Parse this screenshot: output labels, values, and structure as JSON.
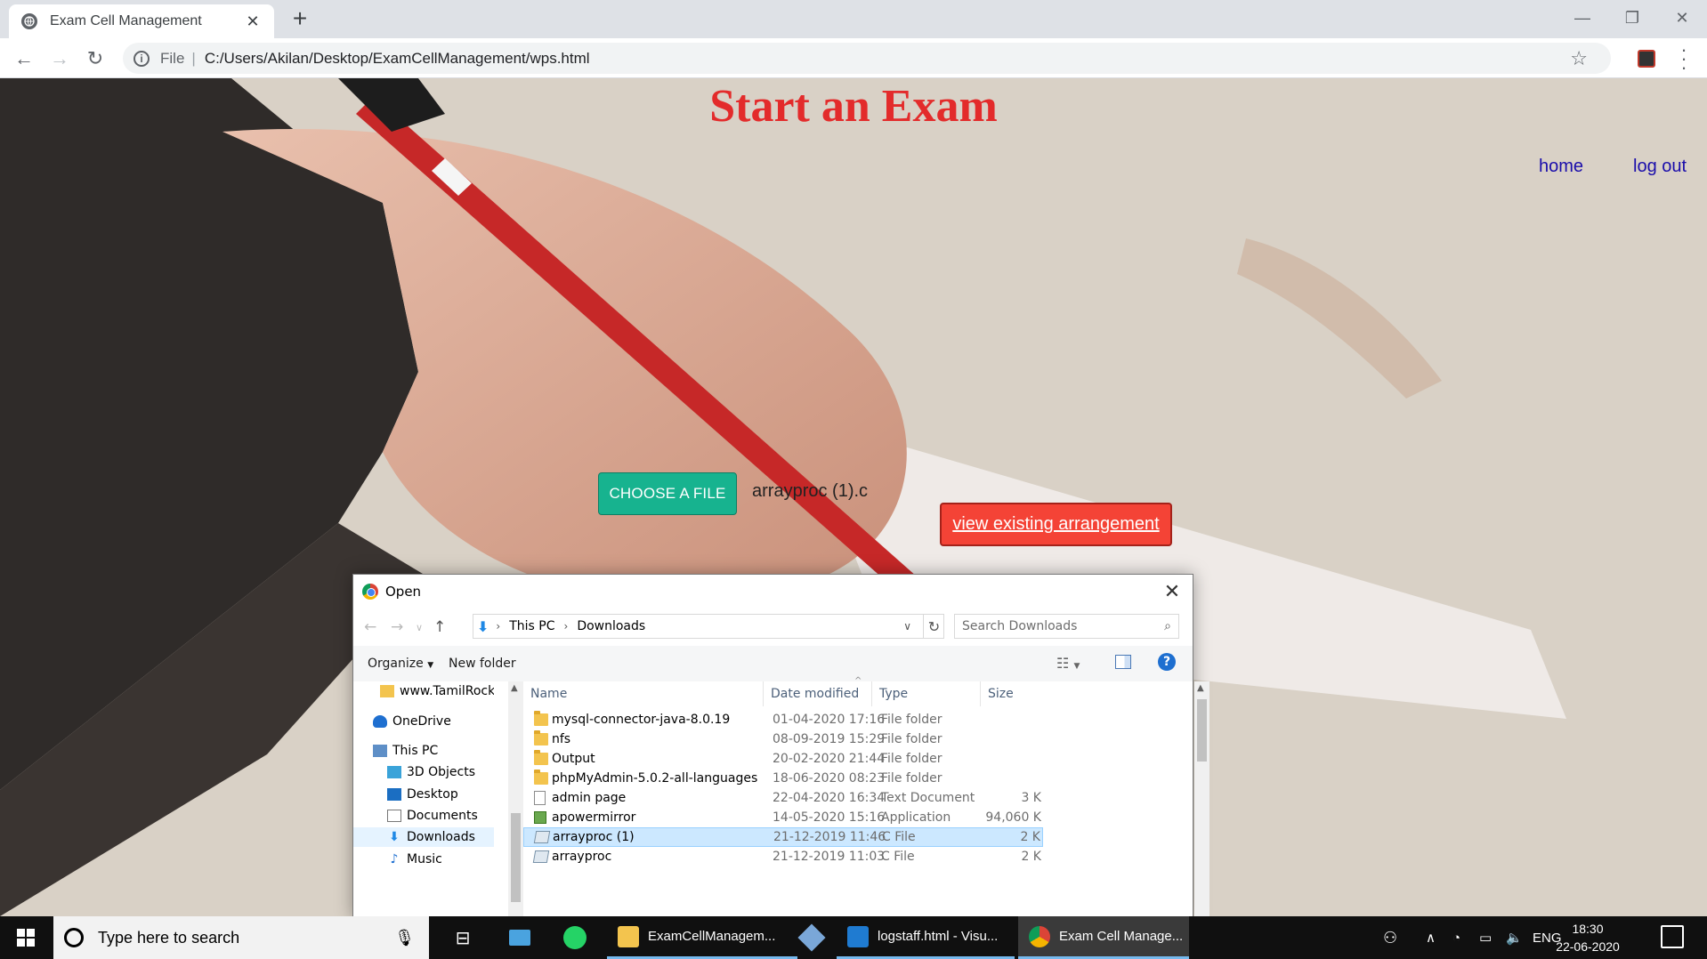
{
  "browser": {
    "tab_title": "Exam Cell Management",
    "new_tab_symbol": "+",
    "scheme_label": "File",
    "url": "C:/Users/Akilan/Desktop/ExamCellManagement/wps.html"
  },
  "page": {
    "title": "Start an Exam",
    "nav": {
      "home": "home",
      "logout": "log out"
    },
    "choose_file_label": "CHOOSE A FILE",
    "chosen_file_name": "arrayproc (1).c",
    "view_arrangement_label": "view existing arrangement",
    "colors": {
      "title": "#e32b2b",
      "choose_button": "#17b38f",
      "view_button": "#f44336",
      "link": "#1a0dab"
    }
  },
  "dialog": {
    "title": "Open",
    "breadcrumb": [
      "This PC",
      "Downloads"
    ],
    "search_placeholder": "Search Downloads",
    "organize_label": "Organize",
    "new_folder_label": "New folder",
    "nav_items": [
      {
        "label": "www.TamilRocke",
        "icon": "folder-icon"
      },
      {
        "label": "OneDrive",
        "icon": "onedrive-icon"
      },
      {
        "label": "This PC",
        "icon": "this-pc-icon"
      },
      {
        "label": "3D Objects",
        "icon": "3d-objects-icon"
      },
      {
        "label": "Desktop",
        "icon": "desktop-icon"
      },
      {
        "label": "Documents",
        "icon": "documents-icon"
      },
      {
        "label": "Downloads",
        "icon": "downloads-icon"
      },
      {
        "label": "Music",
        "icon": "music-icon"
      }
    ],
    "columns": {
      "name": "Name",
      "date": "Date modified",
      "type": "Type",
      "size": "Size"
    },
    "files": [
      {
        "name": "mysql-connector-java-8.0.19",
        "date": "01-04-2020 17:16",
        "type": "File folder",
        "size": "",
        "icon": "folder"
      },
      {
        "name": "nfs",
        "date": "08-09-2019 15:29",
        "type": "File folder",
        "size": "",
        "icon": "folder"
      },
      {
        "name": "Output",
        "date": "20-02-2020 21:44",
        "type": "File folder",
        "size": "",
        "icon": "folder"
      },
      {
        "name": "phpMyAdmin-5.0.2-all-languages",
        "date": "18-06-2020 08:23",
        "type": "File folder",
        "size": "",
        "icon": "folder"
      },
      {
        "name": "admin page",
        "date": "22-04-2020 16:34",
        "type": "Text Document",
        "size": "3 K",
        "icon": "doc"
      },
      {
        "name": "apowermirror",
        "date": "14-05-2020 15:16",
        "type": "Application",
        "size": "94,060 K",
        "icon": "app"
      },
      {
        "name": "arrayproc (1)",
        "date": "21-12-2019 11:46",
        "type": "C File",
        "size": "2 K",
        "icon": "cfile",
        "selected": true
      },
      {
        "name": "arrayproc",
        "date": "21-12-2019 11:03",
        "type": "C File",
        "size": "2 K",
        "icon": "cfile"
      }
    ]
  },
  "taskbar": {
    "search_placeholder": "Type here to search",
    "apps": [
      {
        "label": "ExamCellManagem...",
        "icon": "file-explorer-icon"
      },
      {
        "label": "logstaff.html - Visu...",
        "icon": "vscode-icon"
      },
      {
        "label": "Exam Cell Manage...",
        "icon": "chrome-icon"
      }
    ],
    "language": "ENG",
    "time": "18:30",
    "date": "22-06-2020"
  }
}
